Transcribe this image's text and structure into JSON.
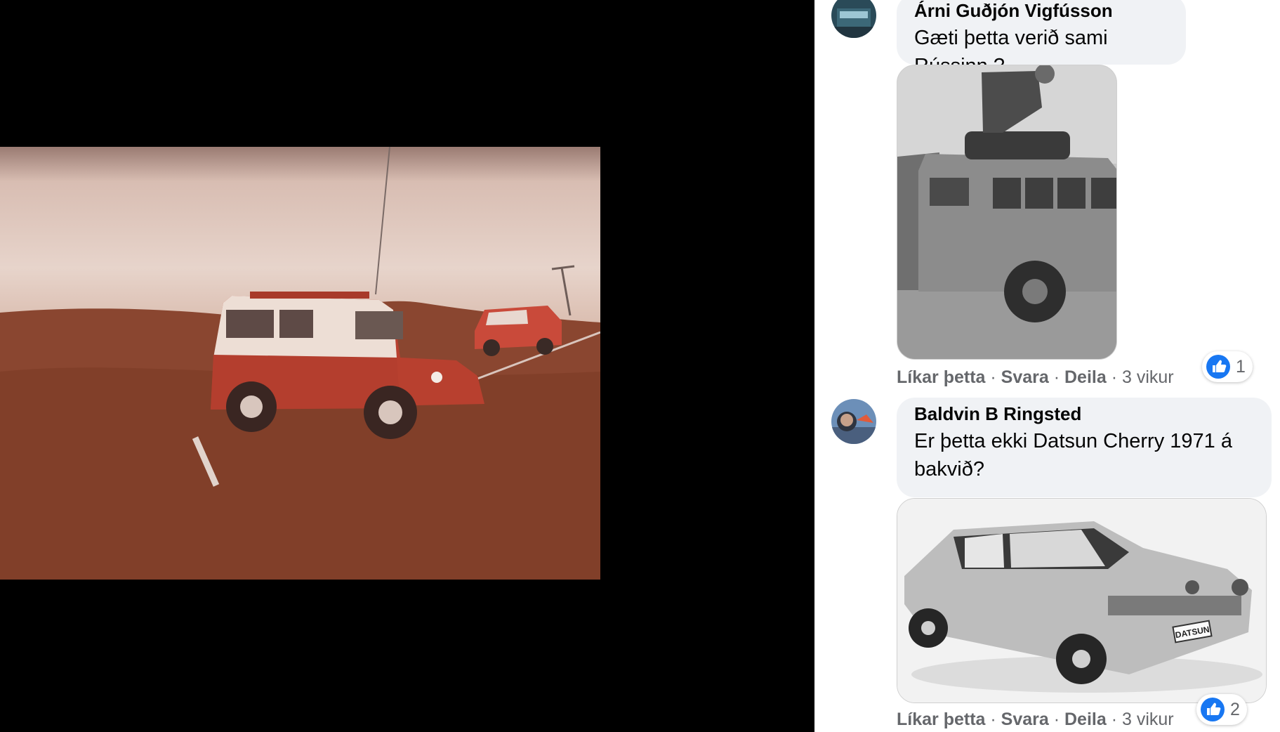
{
  "comments": [
    {
      "author": "Árni Guðjón Vigfússon",
      "text": "Gæti þetta verið sami Rússinn ?",
      "actions": {
        "like": "Líkar þetta",
        "reply": "Svara",
        "share": "Deila",
        "time": "3 vikur"
      },
      "reaction_count": "1"
    },
    {
      "author": "Baldvin B Ringsted",
      "text": "Er þetta ekki Datsun Cherry 1971 á bakvið?",
      "actions": {
        "like": "Líkar þetta",
        "reply": "Svara",
        "share": "Deila",
        "time": "3 vikur"
      },
      "reaction_count": "2"
    }
  ],
  "separator": " · ",
  "image_text": {
    "datsun_plate": "DATSUN"
  },
  "colors": {
    "like_blue": "#1877f2",
    "bubble": "#f0f2f5",
    "meta_gray": "#65676b"
  },
  "icons": {
    "reaction": "thumbs-up-icon"
  }
}
